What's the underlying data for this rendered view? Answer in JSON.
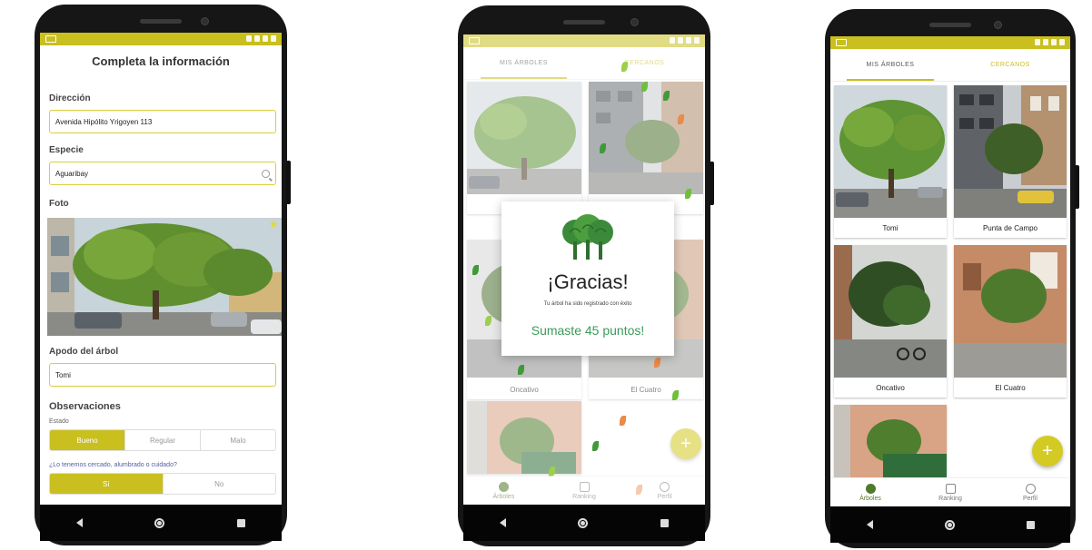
{
  "colors": {
    "accent": "#c9bf1f",
    "success": "#3b9a5a",
    "tree": "#3b8a3a"
  },
  "form": {
    "title": "Completa la información",
    "direccion_label": "Dirección",
    "direccion_value": "Avenida Hipólito Yrigoyen 113",
    "especie_label": "Especie",
    "especie_value": "Aguaribay",
    "foto_label": "Foto",
    "apodo_label": "Apodo del árbol",
    "apodo_value": "Tomi",
    "observaciones_label": "Observaciones",
    "estado_label": "Estado",
    "estado_options": [
      "Bueno",
      "Regular",
      "Malo"
    ],
    "estado_selected": "Bueno",
    "question": "¿Lo tenemos cercado, alumbrado o cuidado?",
    "si_no_options": [
      "Sí",
      "No"
    ],
    "si_no_selected": "Sí"
  },
  "tabs": {
    "mine": "MIS ÁRBOLES",
    "nearby": "CERCANOS"
  },
  "trees": [
    "Tomi",
    "Punta de Campo",
    "Oncativo",
    "El Cuatro",
    ""
  ],
  "dialog": {
    "title": "¡Gracias!",
    "text": "Tu árbol ha sido registrado con éxito",
    "points": "Sumaste 45 puntos!"
  },
  "bottom_nav": [
    "Árboles",
    "Ranking",
    "Perfil"
  ],
  "fab_label": "+"
}
